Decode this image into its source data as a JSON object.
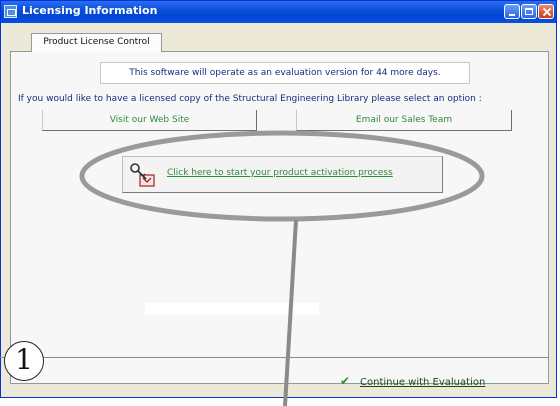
{
  "window": {
    "title": "Licensing Information"
  },
  "tabs": [
    {
      "label": "Product License Control"
    }
  ],
  "main": {
    "evaluation_notice": "This software will operate as an evaluation version for 44 more days.",
    "option_prompt": "If you would like to have a licensed copy of the Structural Engineering Library please select an option :",
    "buttons": {
      "website": "Visit our Web Site",
      "email": "Email our Sales Team"
    },
    "activation": {
      "label": "Click here to start your product activation process",
      "icon": "key-license-icon"
    }
  },
  "footer": {
    "callout_number": "1",
    "continue_label": "Continue with Evaluation",
    "check_icon": "checkmark-icon"
  },
  "colors": {
    "titlebar": "#0a4fd8",
    "link_green": "#2e8b3a",
    "notice_text": "#1a2a80"
  }
}
